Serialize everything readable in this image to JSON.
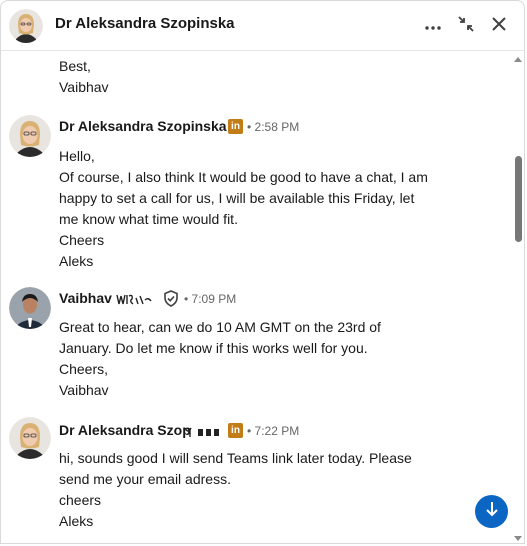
{
  "header": {
    "contact_name": "Dr Aleksandra Szopinska",
    "more_icon": "more-horizontal-icon",
    "minimize_icon": "minimize-arrows-icon",
    "close_icon": "close-icon"
  },
  "colors": {
    "linkedin_badge": "#c37d16",
    "jump_button": "#0a66c2",
    "meta_text": "#666666"
  },
  "messages": [
    {
      "sender": "",
      "time": "",
      "lines": [
        "Best,",
        "Vaibhav"
      ]
    },
    {
      "sender": "Dr Aleksandra Szopinska",
      "badge": "in",
      "time": "• 2:58 PM",
      "lines": [
        "Hello,",
        "Of course, I also think It would be good to have a chat, I am",
        "happy to set a call for us, I will be available this Friday, let",
        "me know what time would fit.",
        "Cheers",
        "Aleks"
      ]
    },
    {
      "sender": "Vaibhav",
      "verified_icon": "verified-shield-icon",
      "time": "• 7:09 PM",
      "lines": [
        "Great to hear, can we do 10 AM GMT on the 23rd of",
        "January. Do let me know if this works well for you.",
        "Cheers,",
        "Vaibhav"
      ]
    },
    {
      "sender": "Dr Aleksandra Szop",
      "badge": "in",
      "time": "• 7:22 PM",
      "lines": [
        "hi, sounds good I will send Teams link later today. Please",
        "send me your email adress.",
        "cheers",
        "Aleks"
      ]
    }
  ],
  "jump_to_latest_icon": "arrow-down-icon"
}
